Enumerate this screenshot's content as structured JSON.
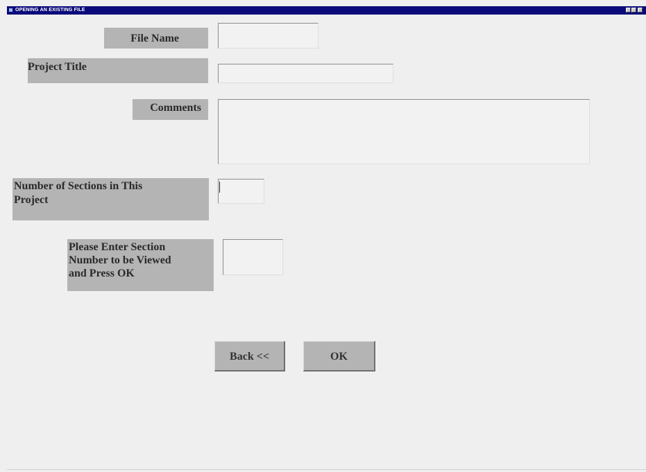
{
  "window": {
    "title": "OPENING AN EXISTING FILE"
  },
  "form": {
    "file_name_label": "File Name",
    "file_name_value": "",
    "project_title_label": "Project Title",
    "project_title_value": "",
    "comments_label": "Comments",
    "comments_value": "",
    "sections_label_line1": "Number of Sections in This",
    "sections_label_line2": "Project",
    "sections_value": "",
    "section_number_label_line1": "Please Enter Section",
    "section_number_label_line2": "Number to be Viewed",
    "section_number_label_line3": "and Press OK",
    "section_number_value": ""
  },
  "buttons": {
    "back_label": "Back <<",
    "ok_label": "OK"
  },
  "colors": {
    "title_bar": "#0a0a7a",
    "label_background": "#b4b4b4",
    "window_background": "#efefef"
  },
  "icons": {
    "app": "app-icon",
    "minimize": "minimize-icon",
    "maximize": "maximize-icon",
    "close": "close-icon"
  }
}
